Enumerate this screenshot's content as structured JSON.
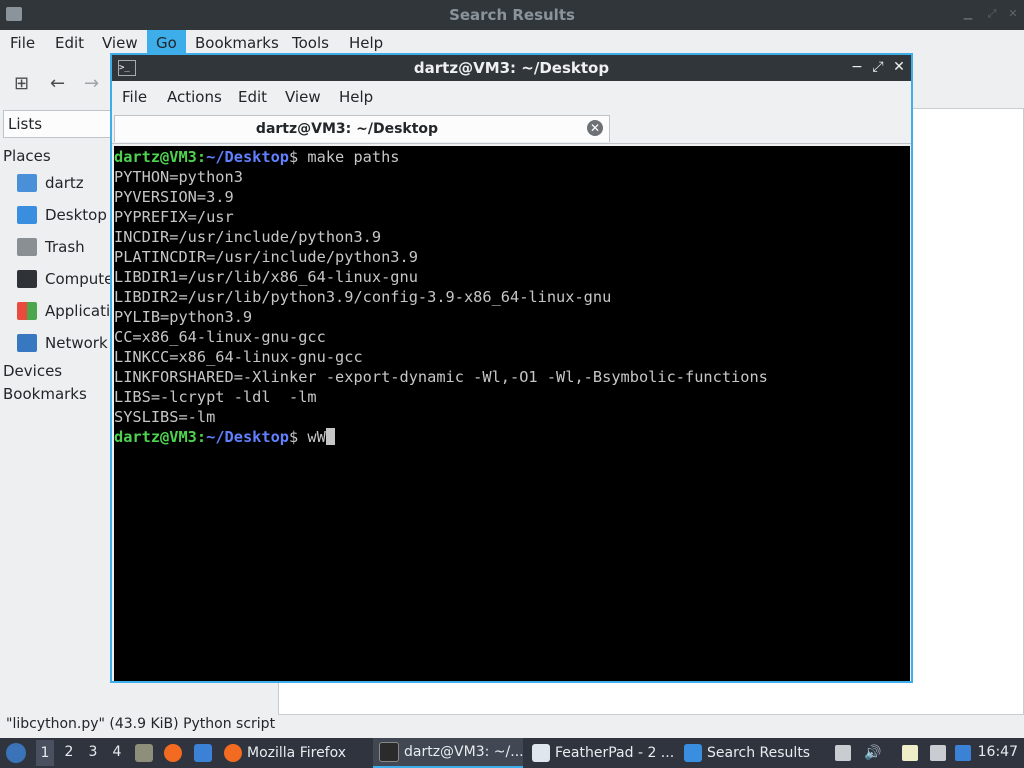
{
  "file_manager": {
    "title": "Search Results",
    "menu": [
      "File",
      "Edit",
      "View",
      "Go",
      "Bookmarks",
      "Tools",
      "Help"
    ],
    "lists_label": "Lists",
    "places_heading": "Places",
    "places": [
      {
        "label": "dartz",
        "icon": "home-folder-icon"
      },
      {
        "label": "Desktop",
        "icon": "desktop-icon"
      },
      {
        "label": "Trash",
        "icon": "trash-icon"
      },
      {
        "label": "Computer",
        "icon": "computer-icon"
      },
      {
        "label": "Applications",
        "icon": "applications-icon"
      },
      {
        "label": "Network",
        "icon": "network-icon"
      }
    ],
    "devices_heading": "Devices",
    "bookmarks_heading": "Bookmarks",
    "status": "\"libcython.py\" (43.9 KiB) Python script"
  },
  "terminal": {
    "title": "dartz@VM3: ~/Desktop",
    "menu": [
      "File",
      "Actions",
      "Edit",
      "View",
      "Help"
    ],
    "tab_label": "dartz@VM3: ~/Desktop",
    "prompt_user": "dartz@VM3",
    "prompt_sep": ":",
    "prompt_path": "~/Desktop",
    "prompt_end": "$ ",
    "command": "make paths",
    "output": [
      "PYTHON=python3",
      "PYVERSION=3.9",
      "PYPREFIX=/usr",
      "INCDIR=/usr/include/python3.9",
      "PLATINCDIR=/usr/include/python3.9",
      "LIBDIR1=/usr/lib/x86_64-linux-gnu",
      "LIBDIR2=/usr/lib/python3.9/config-3.9-x86_64-linux-gnu",
      "PYLIB=python3.9",
      "CC=x86_64-linux-gnu-gcc",
      "LINKCC=x86_64-linux-gnu-gcc",
      "LINKFORSHARED=-Xlinker -export-dynamic -Wl,-O1 -Wl,-Bsymbolic-functions",
      "LIBS=-lcrypt -ldl  -lm",
      "SYSLIBS=-lm"
    ],
    "current_input": "wW"
  },
  "taskbar": {
    "workspaces": [
      "1",
      "2",
      "3",
      "4"
    ],
    "tasks": [
      {
        "label": "Mozilla Firefox",
        "icon": "firefox-icon"
      },
      {
        "label": "dartz@VM3: ~/...",
        "icon": "terminal-icon"
      },
      {
        "label": "FeatherPad - 2 ...",
        "icon": "featherpad-icon"
      },
      {
        "label": "Search Results",
        "icon": "folder-icon"
      }
    ],
    "clock": "16:47"
  },
  "colors": {
    "accent": "#3daee9",
    "titlebar": "#31363b",
    "prompt_user": "#4ed34e",
    "prompt_path": "#6080ff"
  }
}
